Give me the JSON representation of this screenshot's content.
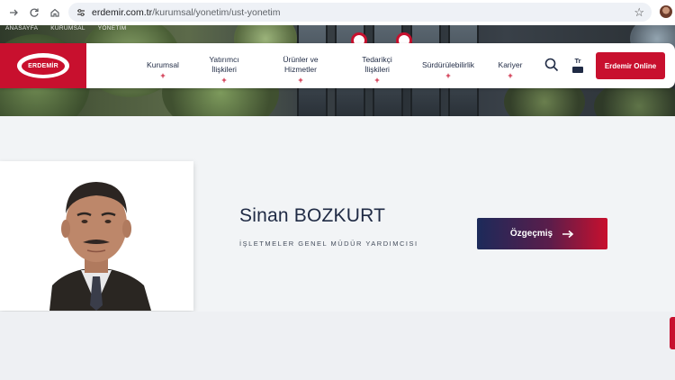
{
  "browser": {
    "url_domain": "erdemir.com.tr",
    "url_path": "/kurumsal/yonetim/ust-yonetim"
  },
  "breadcrumb": [
    "ANASAYFA",
    "KURUMSAL",
    "YÖNETİM"
  ],
  "brand": {
    "name": "ERDEMİR"
  },
  "menu": [
    {
      "label_1": "Kurumsal",
      "label_2": ""
    },
    {
      "label_1": "Yatırımcı",
      "label_2": "İlişkileri"
    },
    {
      "label_1": "Ürünler ve",
      "label_2": "Hizmetler"
    },
    {
      "label_1": "Tedarikçi",
      "label_2": "İlişkileri"
    },
    {
      "label_1": "Sürdürülebilirlik",
      "label_2": ""
    },
    {
      "label_1": "Kariyer",
      "label_2": ""
    }
  ],
  "language": {
    "label": "Tr"
  },
  "online_button": "Erdemir Online",
  "person": {
    "name": "Sinan BOZKURT",
    "title": "İŞLETMELER GENEL MÜDÜR YARDIMCISI",
    "cv_button": "Özgeçmiş"
  },
  "colors": {
    "brand_red": "#c8102e",
    "navy": "#1f2a44"
  },
  "icons": [
    "forward-icon",
    "reload-icon",
    "home-icon",
    "site-info-icon",
    "star-icon",
    "search-icon",
    "keyboard-icon",
    "arrow-right-icon"
  ]
}
